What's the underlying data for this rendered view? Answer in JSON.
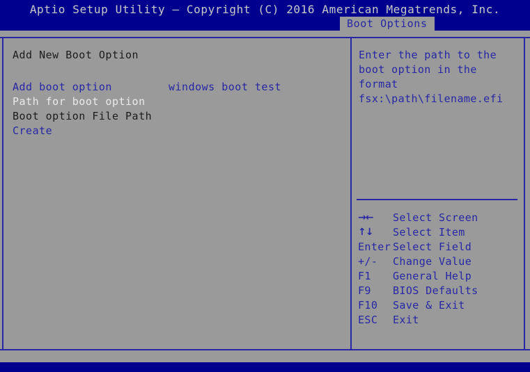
{
  "window": {
    "title": "Aptio Setup Utility – Copyright (C) 2016 American Megatrends, Inc.",
    "active_tab": "Boot Options"
  },
  "colors": {
    "screen_bg": "#9a9a9a",
    "title_bg": "#00008f",
    "accent_blue": "#2727a5",
    "text_dark": "#1c1c1c",
    "text_white": "#eaeaea",
    "title_text": "#c8c8c8"
  },
  "main": {
    "heading": "Add New Boot Option",
    "rows": [
      {
        "label": "Add boot option",
        "value": "windows boot test",
        "label_color": "blue",
        "value_color": "blue",
        "selected": false
      },
      {
        "label": "Path for boot option",
        "value": "",
        "label_color": "white",
        "value_color": "white",
        "selected": true
      },
      {
        "label": "Boot option File Path",
        "value": "",
        "label_color": "dark",
        "value_color": "dark",
        "selected": false
      },
      {
        "label": "Create",
        "value": "",
        "label_color": "blue",
        "value_color": "blue",
        "selected": false
      }
    ]
  },
  "help": {
    "lines": [
      "Enter the path to the",
      "boot option in the",
      "format",
      "fsx:\\path\\filename.efi"
    ]
  },
  "keys": [
    {
      "key": "→←",
      "desc": "Select Screen",
      "icon": "left-right-arrows-icon"
    },
    {
      "key": "↑↓",
      "desc": "Select Item",
      "icon": "up-down-arrows-icon"
    },
    {
      "key": "Enter",
      "desc": "Select Field",
      "icon": "enter-key-icon"
    },
    {
      "key": "+/-",
      "desc": "Change Value",
      "icon": "plus-minus-key-icon"
    },
    {
      "key": "F1",
      "desc": "General Help",
      "icon": "f1-key-icon"
    },
    {
      "key": "F9",
      "desc": "BIOS Defaults",
      "icon": "f9-key-icon"
    },
    {
      "key": "F10",
      "desc": "Save & Exit",
      "icon": "f10-key-icon"
    },
    {
      "key": "ESC",
      "desc": "Exit",
      "icon": "esc-key-icon"
    }
  ]
}
